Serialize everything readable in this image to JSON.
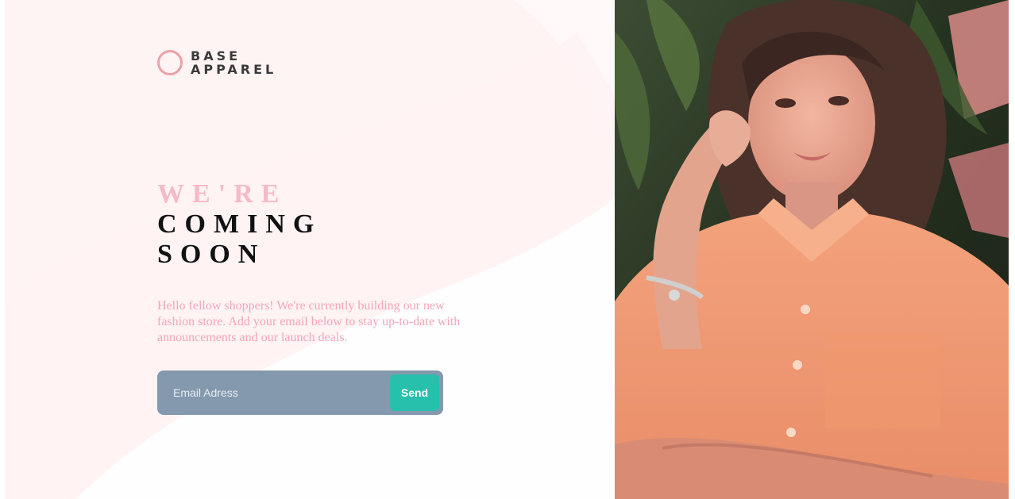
{
  "brand": {
    "line1": "BASE",
    "line2": "APPAREL",
    "accent_color": "#eea0a7"
  },
  "hero": {
    "heading_line1": "WE'RE",
    "heading_line2": "COMING",
    "heading_line3": "SOON",
    "intro": "Hello fellow shoppers! We're currently building our new fashion store. Add your email below to stay up-to-date with announcements and our launch deals."
  },
  "signup": {
    "email_placeholder": "Email Adress",
    "email_value": "",
    "send_label": "Send",
    "send_color": "#26c0ad"
  },
  "photo": {
    "icon": "model-photo"
  }
}
